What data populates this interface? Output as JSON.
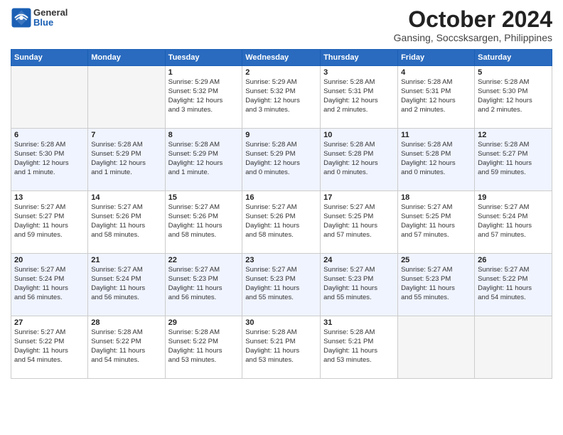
{
  "header": {
    "logo_general": "General",
    "logo_blue": "Blue",
    "month": "October 2024",
    "location": "Gansing, Soccsksargen, Philippines"
  },
  "weekdays": [
    "Sunday",
    "Monday",
    "Tuesday",
    "Wednesday",
    "Thursday",
    "Friday",
    "Saturday"
  ],
  "rows": [
    [
      {
        "day": "",
        "info": ""
      },
      {
        "day": "",
        "info": ""
      },
      {
        "day": "1",
        "info": "Sunrise: 5:29 AM\nSunset: 5:32 PM\nDaylight: 12 hours\nand 3 minutes."
      },
      {
        "day": "2",
        "info": "Sunrise: 5:29 AM\nSunset: 5:32 PM\nDaylight: 12 hours\nand 3 minutes."
      },
      {
        "day": "3",
        "info": "Sunrise: 5:28 AM\nSunset: 5:31 PM\nDaylight: 12 hours\nand 2 minutes."
      },
      {
        "day": "4",
        "info": "Sunrise: 5:28 AM\nSunset: 5:31 PM\nDaylight: 12 hours\nand 2 minutes."
      },
      {
        "day": "5",
        "info": "Sunrise: 5:28 AM\nSunset: 5:30 PM\nDaylight: 12 hours\nand 2 minutes."
      }
    ],
    [
      {
        "day": "6",
        "info": "Sunrise: 5:28 AM\nSunset: 5:30 PM\nDaylight: 12 hours\nand 1 minute."
      },
      {
        "day": "7",
        "info": "Sunrise: 5:28 AM\nSunset: 5:29 PM\nDaylight: 12 hours\nand 1 minute."
      },
      {
        "day": "8",
        "info": "Sunrise: 5:28 AM\nSunset: 5:29 PM\nDaylight: 12 hours\nand 1 minute."
      },
      {
        "day": "9",
        "info": "Sunrise: 5:28 AM\nSunset: 5:29 PM\nDaylight: 12 hours\nand 0 minutes."
      },
      {
        "day": "10",
        "info": "Sunrise: 5:28 AM\nSunset: 5:28 PM\nDaylight: 12 hours\nand 0 minutes."
      },
      {
        "day": "11",
        "info": "Sunrise: 5:28 AM\nSunset: 5:28 PM\nDaylight: 12 hours\nand 0 minutes."
      },
      {
        "day": "12",
        "info": "Sunrise: 5:28 AM\nSunset: 5:27 PM\nDaylight: 11 hours\nand 59 minutes."
      }
    ],
    [
      {
        "day": "13",
        "info": "Sunrise: 5:27 AM\nSunset: 5:27 PM\nDaylight: 11 hours\nand 59 minutes."
      },
      {
        "day": "14",
        "info": "Sunrise: 5:27 AM\nSunset: 5:26 PM\nDaylight: 11 hours\nand 58 minutes."
      },
      {
        "day": "15",
        "info": "Sunrise: 5:27 AM\nSunset: 5:26 PM\nDaylight: 11 hours\nand 58 minutes."
      },
      {
        "day": "16",
        "info": "Sunrise: 5:27 AM\nSunset: 5:26 PM\nDaylight: 11 hours\nand 58 minutes."
      },
      {
        "day": "17",
        "info": "Sunrise: 5:27 AM\nSunset: 5:25 PM\nDaylight: 11 hours\nand 57 minutes."
      },
      {
        "day": "18",
        "info": "Sunrise: 5:27 AM\nSunset: 5:25 PM\nDaylight: 11 hours\nand 57 minutes."
      },
      {
        "day": "19",
        "info": "Sunrise: 5:27 AM\nSunset: 5:24 PM\nDaylight: 11 hours\nand 57 minutes."
      }
    ],
    [
      {
        "day": "20",
        "info": "Sunrise: 5:27 AM\nSunset: 5:24 PM\nDaylight: 11 hours\nand 56 minutes."
      },
      {
        "day": "21",
        "info": "Sunrise: 5:27 AM\nSunset: 5:24 PM\nDaylight: 11 hours\nand 56 minutes."
      },
      {
        "day": "22",
        "info": "Sunrise: 5:27 AM\nSunset: 5:23 PM\nDaylight: 11 hours\nand 56 minutes."
      },
      {
        "day": "23",
        "info": "Sunrise: 5:27 AM\nSunset: 5:23 PM\nDaylight: 11 hours\nand 55 minutes."
      },
      {
        "day": "24",
        "info": "Sunrise: 5:27 AM\nSunset: 5:23 PM\nDaylight: 11 hours\nand 55 minutes."
      },
      {
        "day": "25",
        "info": "Sunrise: 5:27 AM\nSunset: 5:23 PM\nDaylight: 11 hours\nand 55 minutes."
      },
      {
        "day": "26",
        "info": "Sunrise: 5:27 AM\nSunset: 5:22 PM\nDaylight: 11 hours\nand 54 minutes."
      }
    ],
    [
      {
        "day": "27",
        "info": "Sunrise: 5:27 AM\nSunset: 5:22 PM\nDaylight: 11 hours\nand 54 minutes."
      },
      {
        "day": "28",
        "info": "Sunrise: 5:28 AM\nSunset: 5:22 PM\nDaylight: 11 hours\nand 54 minutes."
      },
      {
        "day": "29",
        "info": "Sunrise: 5:28 AM\nSunset: 5:22 PM\nDaylight: 11 hours\nand 53 minutes."
      },
      {
        "day": "30",
        "info": "Sunrise: 5:28 AM\nSunset: 5:21 PM\nDaylight: 11 hours\nand 53 minutes."
      },
      {
        "day": "31",
        "info": "Sunrise: 5:28 AM\nSunset: 5:21 PM\nDaylight: 11 hours\nand 53 minutes."
      },
      {
        "day": "",
        "info": ""
      },
      {
        "day": "",
        "info": ""
      }
    ]
  ]
}
